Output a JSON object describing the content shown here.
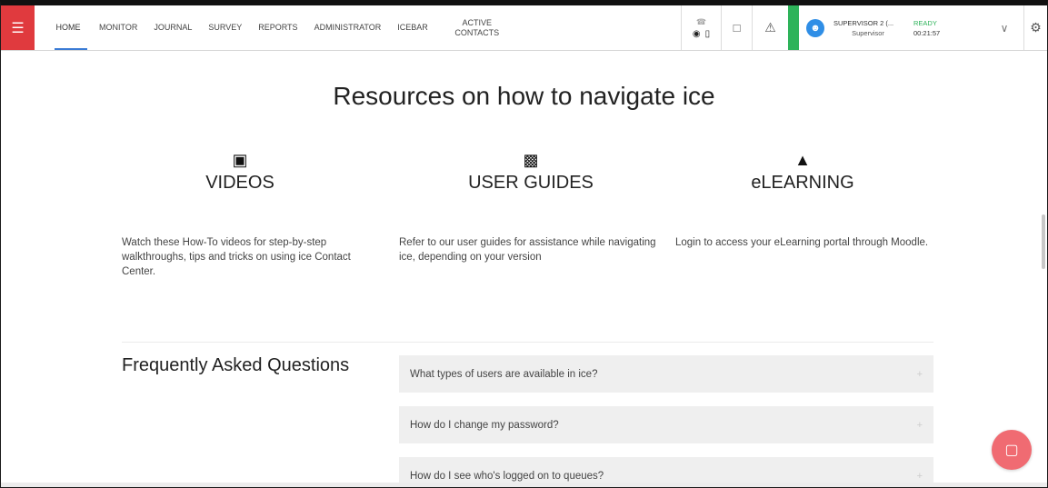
{
  "topbar": {
    "menu_icon": "hamburger-icon",
    "nav": [
      {
        "label": "HOME",
        "active": true
      },
      {
        "label": "MONITOR"
      },
      {
        "label": "JOURNAL"
      },
      {
        "label": "SURVEY"
      },
      {
        "label": "REPORTS"
      },
      {
        "label": "ADMINISTRATOR"
      },
      {
        "label": "ICEBAR"
      },
      {
        "label": "ACTIVE\nCONTACTS"
      }
    ],
    "user": {
      "name": "SUPERVISOR 2 (...",
      "role": "Supervisor",
      "status": "READY",
      "timer": "00:21:57"
    },
    "colors": {
      "accent_red": "#e03a3e",
      "ready_green": "#2eb35a",
      "avatar_blue": "#2f8ee6",
      "tab_underline": "#3a7bd5"
    }
  },
  "main": {
    "title": "Resources on how to navigate ice",
    "columns": [
      {
        "icon": "video-file-icon",
        "heading": "VIDEOS",
        "description": "Watch these How-To videos for step-by-step walkthroughs, tips and tricks on using ice Contact Center."
      },
      {
        "icon": "book-icon",
        "heading": "USER GUIDES",
        "description": "Refer to our user guides for assistance while navigating ice, depending on your version"
      },
      {
        "icon": "graduation-cap-icon",
        "heading": "eLEARNING",
        "description": "Login to access your eLearning portal through Moodle."
      }
    ],
    "faq": {
      "title": "Frequently Asked Questions",
      "items": [
        "What types of users are available in ice?",
        "How do I change my password?",
        "How do I see who's logged on to queues?"
      ]
    },
    "chat_fab_color": "#f06b72"
  }
}
